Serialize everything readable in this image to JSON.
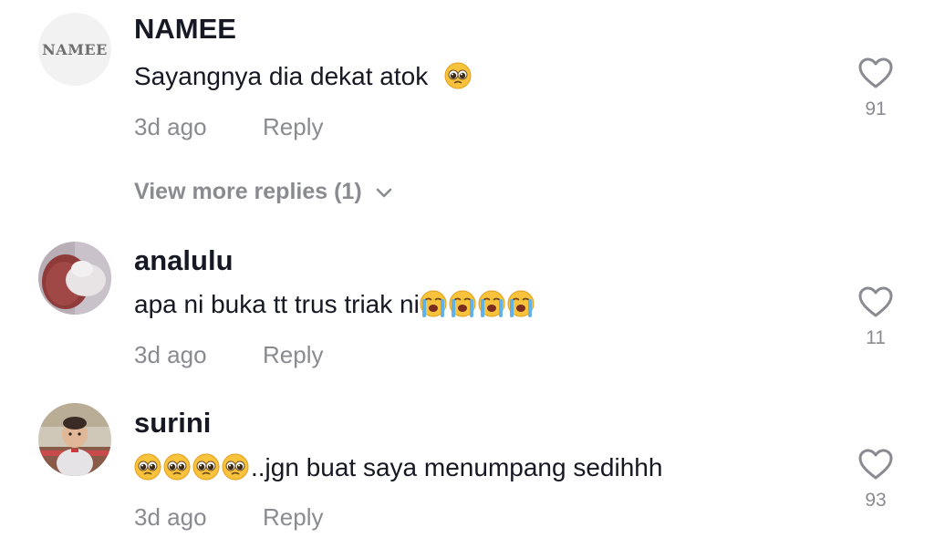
{
  "comments": [
    {
      "username": "NAMEE",
      "avatar_text": "NAMEE",
      "text": "Sayangnya dia dekat atok",
      "emoji": [
        "pleading-face"
      ],
      "time": "3d ago",
      "reply_label": "Reply",
      "likes": "91",
      "view_more": "View more replies (1)"
    },
    {
      "username": "analulu",
      "text": "apa ni buka tt trus triak ni",
      "emoji": [
        "loudly-crying-face",
        "loudly-crying-face",
        "loudly-crying-face",
        "loudly-crying-face"
      ],
      "time": "3d ago",
      "reply_label": "Reply",
      "likes": "11"
    },
    {
      "username": "surini",
      "text": "..jgn buat saya menumpang sedihhh",
      "emoji": [
        "pleading-face",
        "pleading-face",
        "pleading-face",
        "pleading-face"
      ],
      "time": "3d ago",
      "reply_label": "Reply",
      "likes": "93"
    }
  ],
  "colors": {
    "username": "#161823",
    "secondary": "#8a8b91",
    "background": "#ffffff"
  }
}
